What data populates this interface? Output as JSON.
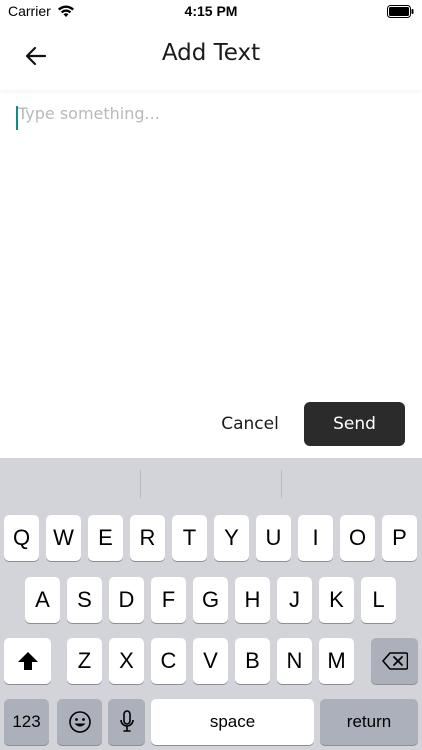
{
  "status": {
    "carrier": "Carrier",
    "time": "4:15 PM"
  },
  "header": {
    "title": "Add Text"
  },
  "input": {
    "placeholder": "Type something..."
  },
  "actions": {
    "cancel_label": "Cancel",
    "send_label": "Send"
  },
  "keyboard": {
    "row1": [
      "Q",
      "W",
      "E",
      "R",
      "T",
      "Y",
      "U",
      "I",
      "O",
      "P"
    ],
    "row2": [
      "A",
      "S",
      "D",
      "F",
      "G",
      "H",
      "J",
      "K",
      "L"
    ],
    "row3": [
      "Z",
      "X",
      "C",
      "V",
      "B",
      "N",
      "M"
    ],
    "numbers_label": "123",
    "space_label": "space",
    "return_label": "return"
  },
  "colors": {
    "send_bg": "#2b2b2b",
    "keyboard_bg": "#d2d4da",
    "caret": "#138a8a"
  }
}
